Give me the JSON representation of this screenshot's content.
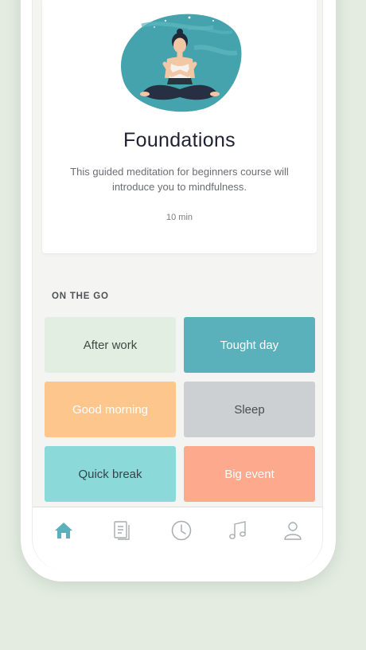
{
  "featured_course": {
    "title": "Foundations",
    "description": "This guided meditation for beginners course will introduce you to mindfulness.",
    "duration": "10 min"
  },
  "on_the_go": {
    "label": "ON THE GO",
    "tiles": [
      {
        "label": "After work",
        "bg": "#e3eee2",
        "fg": "#3f4a45"
      },
      {
        "label": "Tought day",
        "bg": "#5ab0bb",
        "fg": "#ffffff"
      },
      {
        "label": "Good morning",
        "bg": "#fdc68d",
        "fg": "#ffffff"
      },
      {
        "label": "Sleep",
        "bg": "#ccd0d2",
        "fg": "#4a4e52"
      },
      {
        "label": "Quick break",
        "bg": "#8cd9da",
        "fg": "#334548"
      },
      {
        "label": "Big event",
        "bg": "#fca98d",
        "fg": "#ffffff"
      }
    ]
  },
  "tabbar": {
    "items": [
      {
        "icon": "home-icon",
        "active": true
      },
      {
        "icon": "document-icon",
        "active": false
      },
      {
        "icon": "clock-icon",
        "active": false
      },
      {
        "icon": "music-icon",
        "active": false
      },
      {
        "icon": "profile-icon",
        "active": false
      }
    ]
  },
  "colors": {
    "accent": "#5ab0bb",
    "inactive_icon": "#a9acaf",
    "background": "#e4ece2"
  }
}
